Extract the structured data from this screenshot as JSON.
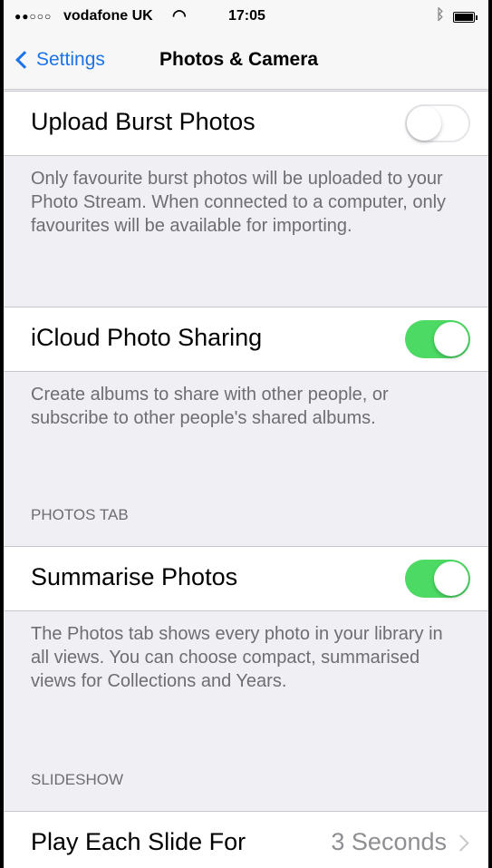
{
  "status_bar": {
    "signal": "●●○○○",
    "carrier": "vodafone UK",
    "wifi_icon": "wifi-icon",
    "time": "17:05",
    "bluetooth_icon": "bluetooth-icon",
    "battery_icon": "battery-icon"
  },
  "nav": {
    "back_label": "Settings",
    "title": "Photos & Camera"
  },
  "rows": {
    "upload_burst": {
      "label": "Upload Burst Photos",
      "toggle": "off"
    },
    "upload_burst_desc": "Only favourite burst photos will be uploaded to your Photo Stream. When connected to a computer, only favourites will be available for importing.",
    "icloud_sharing": {
      "label": "iCloud Photo Sharing",
      "toggle": "on"
    },
    "icloud_sharing_desc": "Create albums to share with other people, or subscribe to other people's shared albums.",
    "photos_tab_header": "PHOTOS TAB",
    "summarise": {
      "label": "Summarise Photos",
      "toggle": "on"
    },
    "summarise_desc": "The Photos tab shows every photo in your library in all views. You can choose compact, summarised views for Collections and Years.",
    "slideshow_header": "SLIDESHOW",
    "play_each": {
      "label": "Play Each Slide For",
      "value": "3 Seconds"
    }
  },
  "colors": {
    "accent": "#1a73e8",
    "toggle_on": "#4cd964",
    "background": "#efeff4"
  }
}
